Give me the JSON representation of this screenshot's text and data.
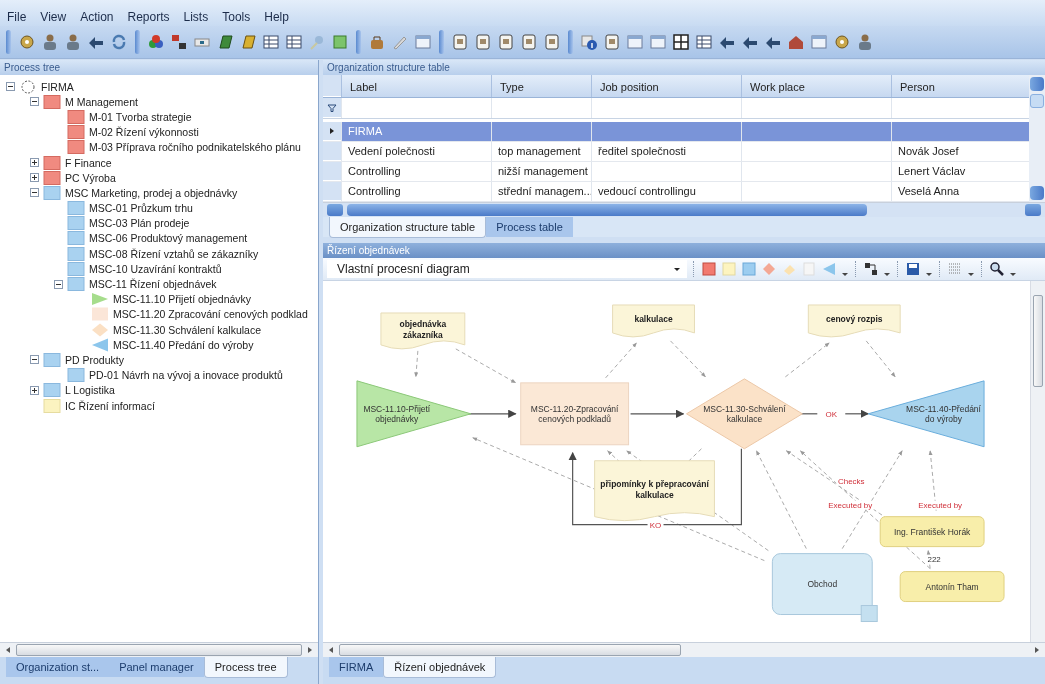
{
  "menu": [
    "File",
    "View",
    "Action",
    "Reports",
    "Lists",
    "Tools",
    "Help"
  ],
  "left_panel": {
    "title": "Process tree",
    "tree": [
      {
        "label": "FIRMA",
        "kind": "circle",
        "expanded": true,
        "children": [
          {
            "label": "M Management",
            "kind": "red",
            "expanded": true,
            "children": [
              {
                "label": "M-01 Tvorba strategie",
                "kind": "red"
              },
              {
                "label": "M-02 Řízení výkonnosti",
                "kind": "red"
              },
              {
                "label": "M-03 Příprava ročního podnikatelského plánu",
                "kind": "red"
              }
            ]
          },
          {
            "label": "F Finance",
            "kind": "red",
            "expanded": false
          },
          {
            "label": "PC Výroba",
            "kind": "red",
            "expanded": false
          },
          {
            "label": "MSC Marketing, prodej a objednávky",
            "kind": "blue",
            "expanded": true,
            "children": [
              {
                "label": "MSC-01 Průzkum trhu",
                "kind": "blue"
              },
              {
                "label": "MSC-03 Plán prodeje",
                "kind": "blue"
              },
              {
                "label": "MSC-06 Produktový management",
                "kind": "blue"
              },
              {
                "label": "MSC-08 Řízení vztahů se zákazníky",
                "kind": "blue"
              },
              {
                "label": "MSC-10 Uzavírání kontraktů",
                "kind": "blue"
              },
              {
                "label": "MSC-11 Řízení objednávek",
                "kind": "blue",
                "expanded": true,
                "children": [
                  {
                    "label": "MSC-11.10 Přijetí objednávky",
                    "kind": "start"
                  },
                  {
                    "label": "MSC-11.20 Zpracování cenových podklad",
                    "kind": "process"
                  },
                  {
                    "label": "MSC-11.30 Schválení kalkulace",
                    "kind": "decision"
                  },
                  {
                    "label": "MSC-11.40 Předání do výroby",
                    "kind": "end"
                  }
                ]
              }
            ]
          },
          {
            "label": "PD Produkty",
            "kind": "blue",
            "expanded": true,
            "children": [
              {
                "label": "PD-01 Návrh na vývoj a inovace produktů",
                "kind": "blue"
              }
            ]
          },
          {
            "label": "L Logistika",
            "kind": "blue",
            "expanded": false
          },
          {
            "label": "IC Řízení informací",
            "kind": "yellow"
          }
        ]
      }
    ],
    "tabs": [
      {
        "label": "Organization st...",
        "selected": false
      },
      {
        "label": "Panel manager",
        "selected": false
      },
      {
        "label": "Process tree",
        "selected": true
      }
    ]
  },
  "org_table": {
    "title": "Organization structure table",
    "columns": [
      "Label",
      "Type",
      "Job position",
      "Work place",
      "Person"
    ],
    "rows": [
      {
        "label": "FIRMA",
        "selected": true
      },
      {
        "label": "Vedení polečnosti",
        "type": "top management",
        "job_position": "ředitel společnosti",
        "person": "Novák Josef",
        "selected": false
      },
      {
        "label": "Controlling",
        "type": "nižší management",
        "person": "Lenert Václav",
        "selected": false
      },
      {
        "label": "Controlling",
        "type": "střední managem...",
        "job_position": "vedoucí controllingu",
        "person": "Veselá Anna",
        "selected": false
      }
    ],
    "tabs": [
      {
        "label": "Organization structure table",
        "selected": true
      },
      {
        "label": "Process table",
        "selected": false
      }
    ]
  },
  "diagram": {
    "title": "Řízení objednávek",
    "view": "Vlastní procesní diagram",
    "nodes": [
      {
        "kind": "document",
        "label": "objednávka zákazníka"
      },
      {
        "kind": "document",
        "label": "kalkulace"
      },
      {
        "kind": "document",
        "label": "cenový rozpis"
      },
      {
        "kind": "start",
        "label": "MSC-11.10-Přijetí objednávky"
      },
      {
        "kind": "process",
        "label": "MSC-11.20-Zpracování cenových podkladů"
      },
      {
        "kind": "decision",
        "label": "MSC-11.30-Schválení kalkulace"
      },
      {
        "kind": "end",
        "label": "MSC-11.40-Předání do výroby"
      },
      {
        "kind": "document",
        "label": "připomínky k přepracování kalkulace"
      },
      {
        "kind": "role",
        "label": "Obchod"
      },
      {
        "kind": "person",
        "label": "Ing. František Horák"
      },
      {
        "kind": "person",
        "label": "Antonín Tham"
      }
    ],
    "edge_labels": [
      {
        "kind": "relation",
        "label": "OK"
      },
      {
        "kind": "relation",
        "label": "KO"
      },
      {
        "kind": "relation",
        "label": "Checks"
      },
      {
        "kind": "relation",
        "label": "Executed by"
      },
      {
        "kind": "relation",
        "label": "Executed by"
      },
      {
        "kind": "attribute",
        "label": "222"
      }
    ],
    "tabs": [
      {
        "label": "FIRMA",
        "selected": false
      },
      {
        "label": "Řízení objednávek",
        "selected": true
      }
    ]
  }
}
